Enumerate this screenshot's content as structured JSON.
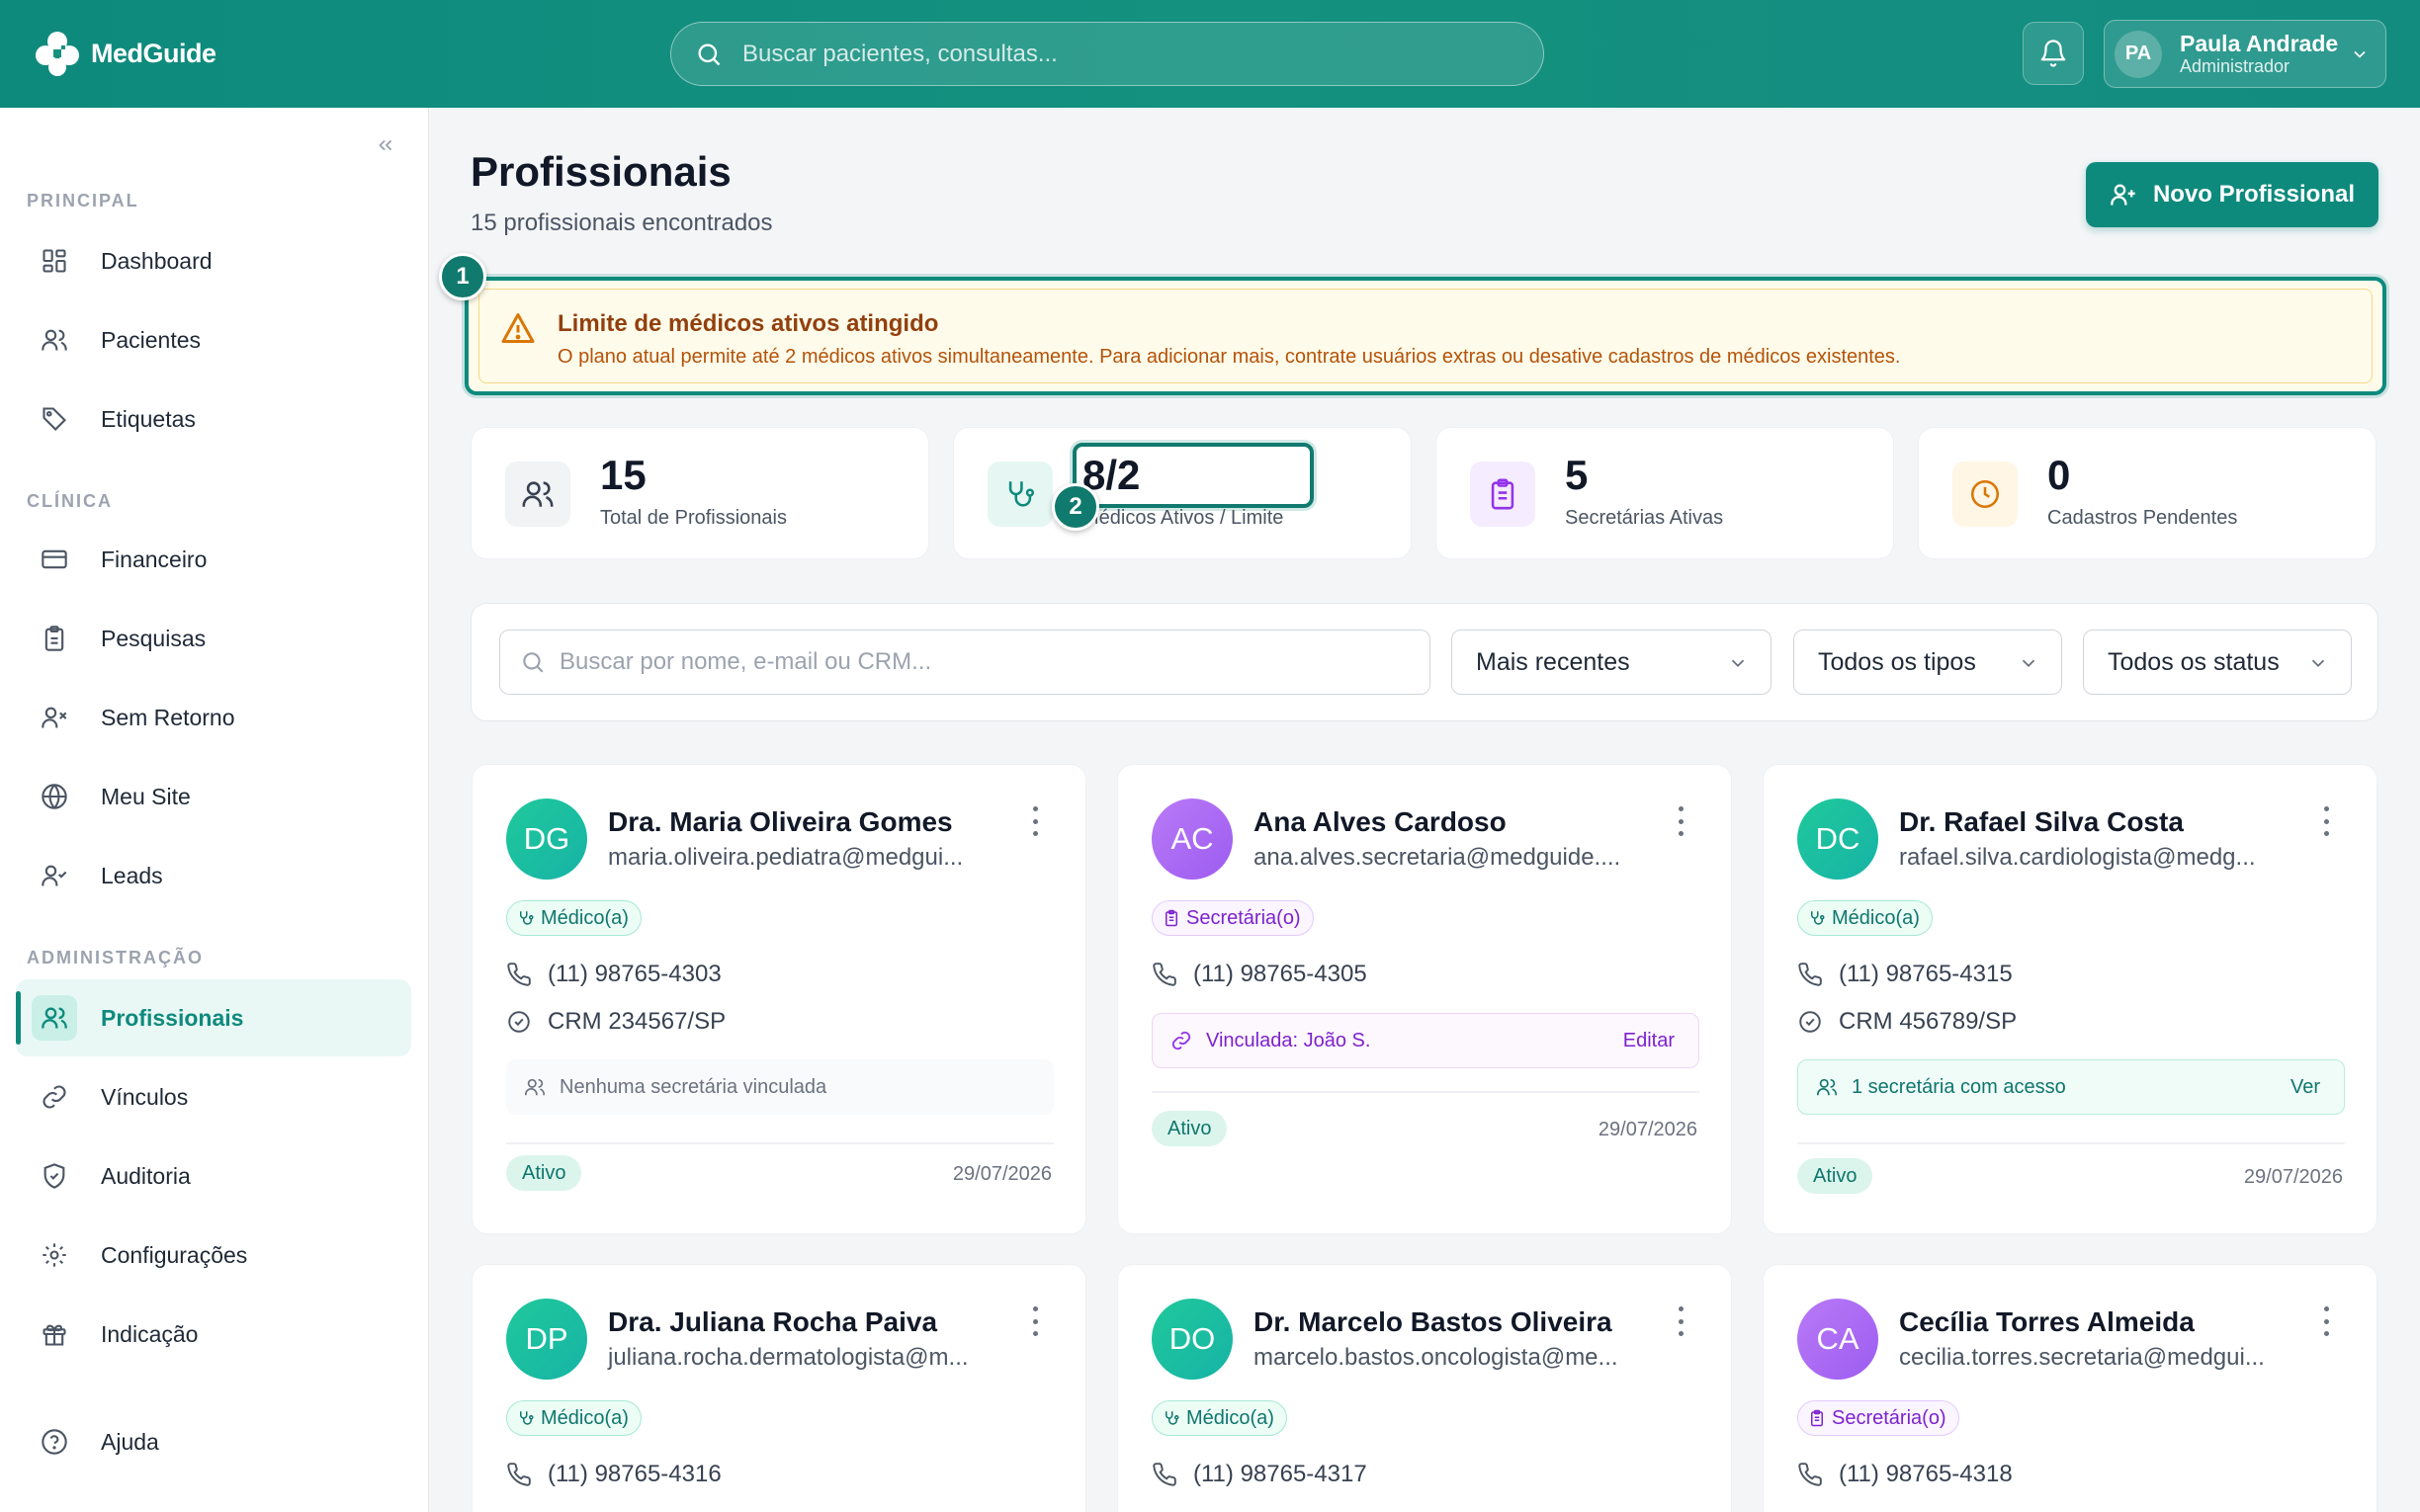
{
  "app": {
    "logo_text": "MedGuide"
  },
  "topbar": {
    "search_placeholder": "Buscar pacientes, consultas...",
    "user": {
      "initials": "PA",
      "name": "Paula Andrade",
      "role": "Administrador"
    }
  },
  "sidebar": {
    "sections": {
      "principal": "PRINCIPAL",
      "clinica": "CLÍNICA",
      "administracao": "ADMINISTRAÇÃO"
    },
    "items": {
      "dashboard": "Dashboard",
      "pacientes": "Pacientes",
      "etiquetas": "Etiquetas",
      "financeiro": "Financeiro",
      "pesquisas": "Pesquisas",
      "sem_retorno": "Sem Retorno",
      "meu_site": "Meu Site",
      "leads": "Leads",
      "profissionais": "Profissionais",
      "vinculos": "Vínculos",
      "auditoria": "Auditoria",
      "configuracoes": "Configurações",
      "indicacao": "Indicação",
      "ajuda": "Ajuda"
    }
  },
  "page": {
    "title": "Profissionais",
    "subtitle": "15 profissionais encontrados",
    "new_button": "Novo Profissional"
  },
  "alert": {
    "marker": "1",
    "title": "Limite de médicos ativos atingido",
    "text": "O plano atual permite até 2 médicos ativos simultaneamente. Para adicionar mais, contrate usuários extras ou desative cadastros de médicos existentes."
  },
  "stats": {
    "marker": "2",
    "total": {
      "value": "15",
      "label": "Total de Profissionais"
    },
    "medicos": {
      "value": "8/2",
      "label": "Médicos Ativos / Limite"
    },
    "secretarias": {
      "value": "5",
      "label": "Secretárias Ativas"
    },
    "pendentes": {
      "value": "0",
      "label": "Cadastros Pendentes"
    }
  },
  "filters": {
    "search_placeholder": "Buscar por nome, e-mail ou CRM...",
    "sort": "Mais recentes",
    "type": "Todos os tipos",
    "status": "Todos os status"
  },
  "cards": [
    {
      "initials": "DG",
      "name": "Dra. Maria Oliveira Gomes",
      "email": "maria.oliveira.pediatra@medgui...",
      "tag": "Médico(a)",
      "phone": "(11) 98765-4303",
      "crm": "CRM 234567/SP",
      "box": "Nenhuma secretária vinculada",
      "status": "Ativo",
      "date": "29/07/2026"
    },
    {
      "initials": "AC",
      "name": "Ana Alves Cardoso",
      "email": "ana.alves.secretaria@medguide....",
      "tag": "Secretária(o)",
      "phone": "(11) 98765-4305",
      "box": "Vinculada: João S.",
      "box_action": "Editar",
      "status": "Ativo",
      "date": "29/07/2026"
    },
    {
      "initials": "DC",
      "name": "Dr. Rafael Silva Costa",
      "email": "rafael.silva.cardiologista@medg...",
      "tag": "Médico(a)",
      "phone": "(11) 98765-4315",
      "crm": "CRM 456789/SP",
      "box": "1 secretária com acesso",
      "box_action": "Ver",
      "status": "Ativo",
      "date": "29/07/2026"
    },
    {
      "initials": "DP",
      "name": "Dra. Juliana Rocha Paiva",
      "email": "juliana.rocha.dermatologista@m...",
      "tag": "Médico(a)",
      "phone": "(11) 98765-4316"
    },
    {
      "initials": "DO",
      "name": "Dr. Marcelo Bastos Oliveira",
      "email": "marcelo.bastos.oncologista@me...",
      "tag": "Médico(a)",
      "phone": "(11) 98765-4317"
    },
    {
      "initials": "CA",
      "name": "Cecília Torres Almeida",
      "email": "cecilia.torres.secretaria@medgui...",
      "tag": "Secretária(o)",
      "phone": "(11) 98765-4318"
    }
  ]
}
